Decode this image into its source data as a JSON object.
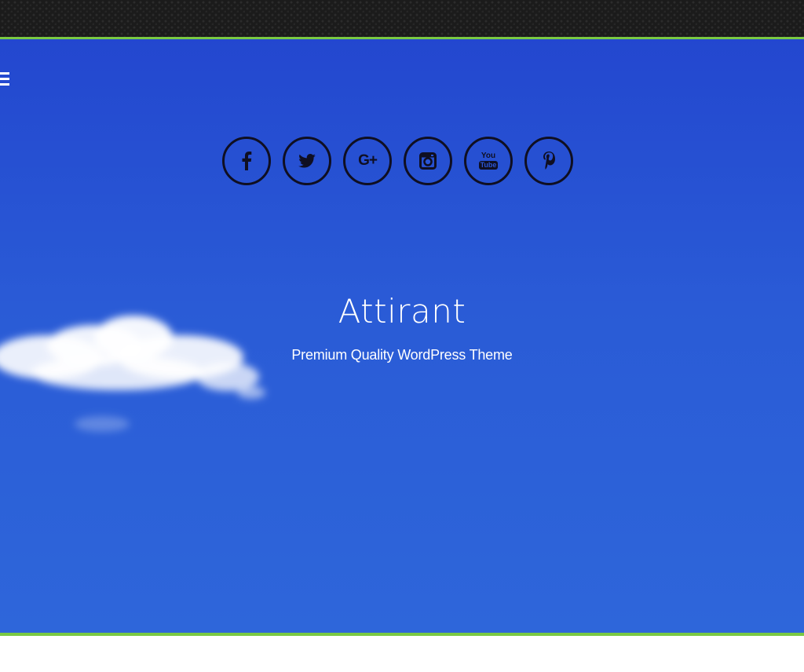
{
  "site": {
    "title": "Attirant",
    "tagline": "Premium Quality WordPress Theme"
  },
  "menu": {
    "icon": "hamburger-menu-icon"
  },
  "social": [
    {
      "name": "facebook",
      "icon": "facebook-icon"
    },
    {
      "name": "twitter",
      "icon": "twitter-icon"
    },
    {
      "name": "google-plus",
      "icon": "google-plus-icon",
      "glyph": "G+"
    },
    {
      "name": "instagram",
      "icon": "instagram-icon"
    },
    {
      "name": "youtube",
      "icon": "youtube-icon",
      "glyph_top": "You",
      "glyph_bottom": "Tube"
    },
    {
      "name": "pinterest",
      "icon": "pinterest-icon"
    }
  ],
  "colors": {
    "accent": "#7ac943",
    "header_bg": "#1b1b1b",
    "sky_top": "#2347cf",
    "sky_bottom": "#2e66da",
    "icon_stroke": "#0f0f22",
    "text": "#ffffff"
  }
}
